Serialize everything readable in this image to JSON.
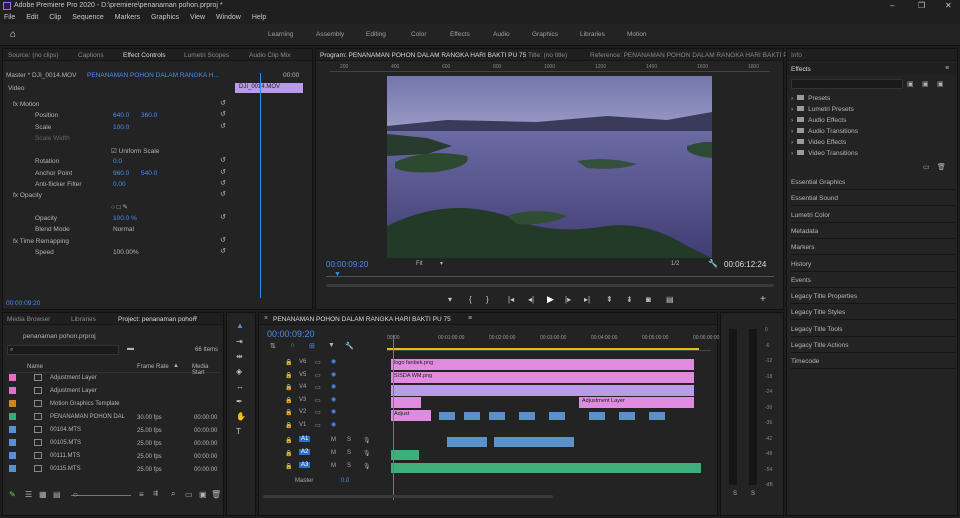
{
  "window": {
    "title": "Adobe Premiere Pro 2020 - D:\\premiere\\penanaman pohon.prproj *",
    "minimize": "–",
    "maximize": "❐",
    "close": "✕"
  },
  "menu": [
    "File",
    "Edit",
    "Clip",
    "Sequence",
    "Markers",
    "Graphics",
    "View",
    "Window",
    "Help"
  ],
  "workspaces": [
    "Learning",
    "Assembly",
    "Editing",
    "Color",
    "Effects",
    "Audio",
    "Graphics",
    "Libraries",
    "Motion"
  ],
  "source_panel": {
    "tabs": [
      "Source: (no clips)",
      "Captions",
      "Effect Controls",
      "Lumetri Scopes",
      "Audio Clip Mix"
    ],
    "master": "Master * DJI_0014.MOV",
    "sequence": "PENANAMAN POHON DALAM RANGKA H...",
    "section": "Video",
    "time_short": "00:00",
    "clip_name": "DJI_0014.MOV",
    "props": [
      {
        "label": "fx Motion",
        "v1": "",
        "v2": ""
      },
      {
        "label": "Position",
        "v1": "640.0",
        "v2": "360.0"
      },
      {
        "label": "Scale",
        "v1": "100.0",
        "v2": ""
      },
      {
        "label": "Scale Width",
        "v1": "",
        "v2": ""
      },
      {
        "label": "☑ Uniform Scale",
        "v1": "",
        "v2": ""
      },
      {
        "label": "Rotation",
        "v1": "0.0",
        "v2": ""
      },
      {
        "label": "Anchor Point",
        "v1": "960.0",
        "v2": "540.0"
      },
      {
        "label": "Anti-flicker Filter",
        "v1": "0.00",
        "v2": ""
      },
      {
        "label": "fx Opacity",
        "v1": "",
        "v2": ""
      },
      {
        "label": "○ □ ✎",
        "v1": "",
        "v2": ""
      },
      {
        "label": "Opacity",
        "v1": "100.0 %",
        "v2": ""
      },
      {
        "label": "Blend Mode",
        "v1": "Normal",
        "v2": ""
      },
      {
        "label": "fx Time Remapping",
        "v1": "",
        "v2": ""
      },
      {
        "label": "Speed",
        "v1": "100.00%",
        "v2": ""
      }
    ],
    "timecode": "00:00:09:20"
  },
  "program": {
    "tabs": [
      "Program: PENANAMAN POHON DALAM RANGKA HARI BAKTI PU 75",
      "Title: (no title)",
      "Reference: PENANAMAN POHON DALAM RANGKA HARI BAKTI PU 75"
    ],
    "ruler": [
      "200",
      "400",
      "600",
      "800",
      "1000",
      "1200",
      "1400",
      "1600",
      "1800"
    ],
    "timecode": "00:00:09:20",
    "fit": "Fit",
    "ratio": "1/2",
    "duration": "00:06:12:24"
  },
  "project": {
    "tabs": [
      "Media Browser",
      "Libraries",
      "Project: penanaman pohon"
    ],
    "file": "penanaman pohon.prproj",
    "items_count": "66 Items",
    "columns": [
      "Name",
      "Frame Rate",
      "Media Start"
    ],
    "rows": [
      {
        "name": "Adjustment Layer",
        "rate": "",
        "start": "",
        "color": "#e46fc5"
      },
      {
        "name": "Adjustment Layer",
        "rate": "",
        "start": "",
        "color": "#e46fc5"
      },
      {
        "name": "Motion Graphics Template",
        "rate": "",
        "start": "",
        "color": "#d1851f"
      },
      {
        "name": "PENANAMAN POHON DAL",
        "rate": "30.00 fps",
        "start": "00:00:00",
        "color": "#2fae7a"
      },
      {
        "name": "00104.MTS",
        "rate": "25.00 fps",
        "start": "00:00:00",
        "color": "#5a8fd8"
      },
      {
        "name": "00105.MTS",
        "rate": "25.00 fps",
        "start": "00:00:00",
        "color": "#5a8fd8"
      },
      {
        "name": "00111.MTS",
        "rate": "25.00 fps",
        "start": "00:00:00",
        "color": "#5a8fd8"
      },
      {
        "name": "00115.MTS",
        "rate": "25.00 fps",
        "start": "00:00:00",
        "color": "#5a8fd8"
      }
    ]
  },
  "timeline": {
    "title": "PENANAMAN POHON DALAM RANGKA HARI BAKTI PU 75",
    "timecode": "00:00:09:20",
    "ruler": [
      "00:00",
      "00:01:00:00",
      "00:02:00:00",
      "00:03:00:00",
      "00:04:00:00",
      "00:05:00:00",
      "00:06:00:00"
    ],
    "video_tracks": [
      "V6",
      "V5",
      "V4",
      "V3",
      "V2",
      "V1"
    ],
    "audio_tracks": [
      "A1",
      "A2",
      "A3"
    ],
    "master": "Master",
    "master_val": "0.0",
    "clips": {
      "logo": "logo fanbek.png",
      "sisda": "SISDA WM.png",
      "adj": "Adjustment Layer",
      "adjust_short": "Adjust"
    }
  },
  "effects": {
    "tab_info": "Info",
    "tab_effects": "Effects",
    "tree": [
      "Presets",
      "Lumetri Presets",
      "Audio Effects",
      "Audio Transitions",
      "Video Effects",
      "Video Transitions"
    ],
    "panels": [
      "Essential Graphics",
      "Essential Sound",
      "Lumetri Color",
      "Metadata",
      "Markers",
      "History",
      "Events",
      "Legacy Title Properties",
      "Legacy Title Styles",
      "Legacy Title Tools",
      "Legacy Title Actions",
      "Timecode"
    ]
  },
  "meter": {
    "scale": [
      "0",
      "-6",
      "-12",
      "-18",
      "-24",
      "-30",
      "-36",
      "-42",
      "-48",
      "-54",
      "-dB"
    ],
    "solo": "S"
  },
  "colors": {
    "accent": "#2d8ceb",
    "clip_pink": "#e08be0",
    "clip_violet": "#b99be9",
    "clip_audio": "#3fae7a",
    "clip_blue": "#5c92c9"
  }
}
